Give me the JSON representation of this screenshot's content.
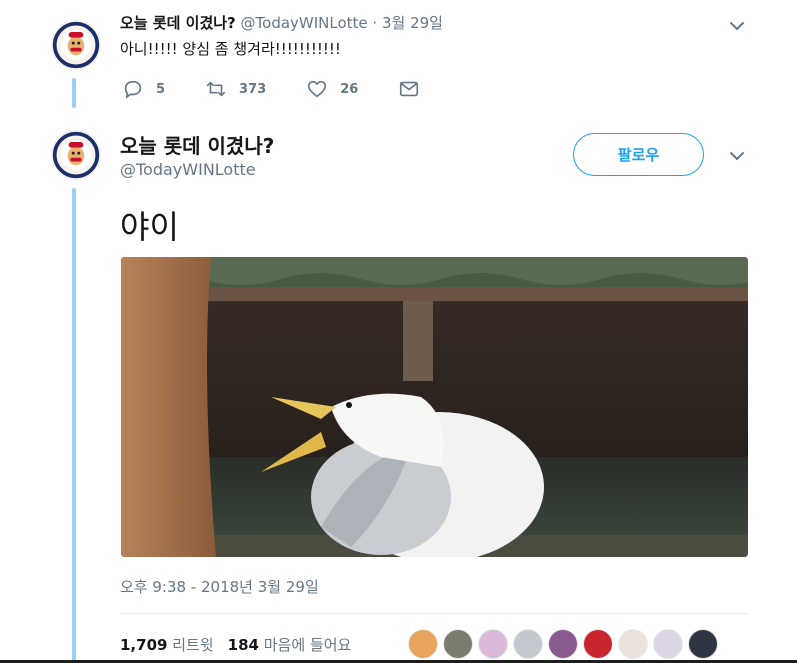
{
  "tweet1": {
    "display_name": "오늘 롯데 이겼나?",
    "meta": "@TodayWINLotte · 3월 29일",
    "text": "아니!!!!! 양심 좀 챙겨라!!!!!!!!!!!",
    "replies": "5",
    "retweets": "373",
    "likes": "26"
  },
  "tweet2": {
    "display_name": "오늘 롯데 이겼나?",
    "handle": "@TodayWINLotte",
    "follow_label": "팔로우",
    "text": "야이",
    "timestamp": "오후 9:38 - 2018년 3월 29일",
    "retweet_count": "1,709",
    "retweet_label": "리트윗",
    "like_count": "184",
    "like_label": "마음에 들어요"
  },
  "icons": {
    "reply": "reply-icon",
    "retweet": "retweet-icon",
    "like": "heart-icon",
    "dm": "envelope-icon",
    "more": "chevron-down-icon"
  },
  "colors": {
    "accent": "#1da1f2",
    "thread_line": "#9ad0f5",
    "secondary_text": "#657786"
  }
}
